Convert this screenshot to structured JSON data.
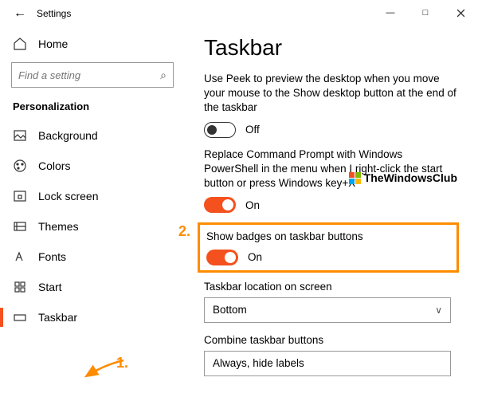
{
  "window": {
    "title": "Settings"
  },
  "search": {
    "placeholder": "Find a setting"
  },
  "home_label": "Home",
  "category": "Personalization",
  "sidebar": {
    "items": [
      {
        "label": "Background"
      },
      {
        "label": "Colors"
      },
      {
        "label": "Lock screen"
      },
      {
        "label": "Themes"
      },
      {
        "label": "Fonts"
      },
      {
        "label": "Start"
      },
      {
        "label": "Taskbar"
      }
    ]
  },
  "main": {
    "heading": "Taskbar",
    "peek_desc": "Use Peek to preview the desktop when you move your mouse to the Show desktop button at the end of the taskbar",
    "peek_state": "Off",
    "cmd_desc": "Replace Command Prompt with Windows PowerShell in the menu when I right-click the start button or press Windows key+X",
    "cmd_state": "On",
    "badges_desc": "Show badges on taskbar buttons",
    "badges_state": "On",
    "location_label": "Taskbar location on screen",
    "location_value": "Bottom",
    "combine_label": "Combine taskbar buttons",
    "combine_value": "Always, hide labels"
  },
  "annotations": {
    "a1": "1.",
    "a2": "2."
  },
  "watermark": "TheWindowsClub"
}
